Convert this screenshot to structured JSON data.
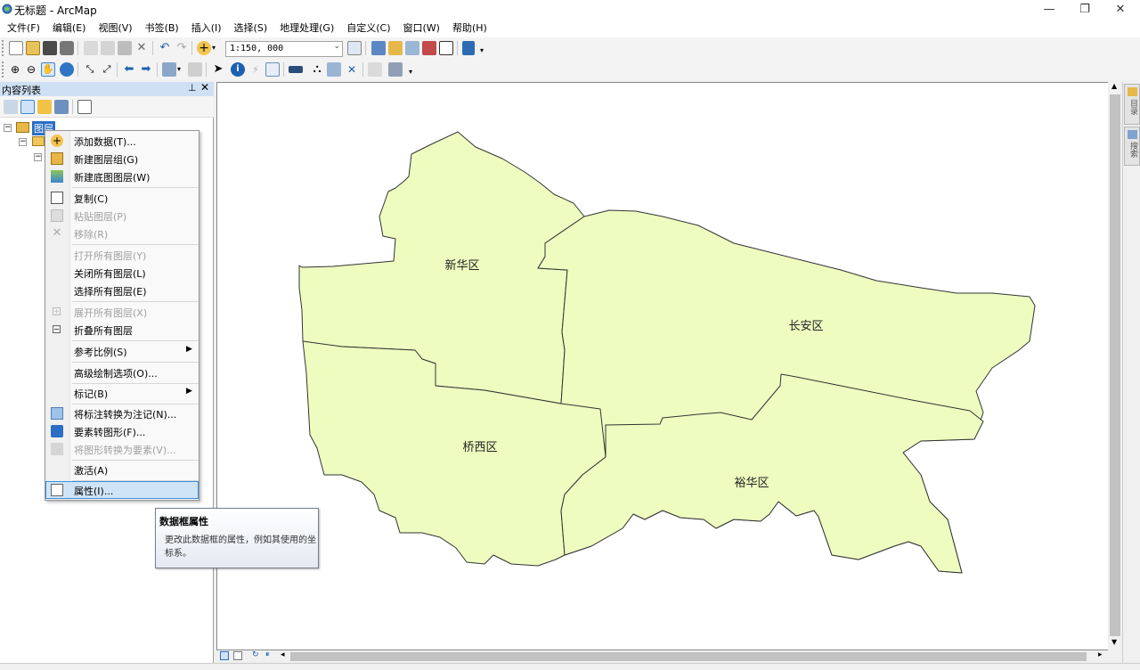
{
  "window": {
    "title": "无标题 - ArcMap",
    "minimize": "—",
    "restore": "❐",
    "close": "✕"
  },
  "menubar": [
    "文件(F)",
    "编辑(E)",
    "视图(V)",
    "书签(B)",
    "插入(I)",
    "选择(S)",
    "地理处理(G)",
    "自定义(C)",
    "窗口(W)",
    "帮助(H)"
  ],
  "toolbar": {
    "scale": "1:150, 000"
  },
  "toc": {
    "title": "内容列表",
    "pin": "ᵖ",
    "close": "✕",
    "root_layer": "图层"
  },
  "context_menu": {
    "items": [
      {
        "label": "添加数据(T)...",
        "icon": "add-data-icon",
        "enabled": true
      },
      {
        "label": "新建图层组(G)",
        "icon": "new-group-layer-icon",
        "enabled": true
      },
      {
        "label": "新建底图图层(W)",
        "icon": "new-basemap-layer-icon",
        "enabled": true
      },
      {
        "label": "复制(C)",
        "icon": "copy-icon",
        "enabled": true
      },
      {
        "label": "粘贴图层(P)",
        "icon": "paste-icon",
        "enabled": false
      },
      {
        "label": "移除(R)",
        "icon": "remove-icon",
        "enabled": false
      },
      {
        "label": "打开所有图层(Y)",
        "icon": "",
        "enabled": false
      },
      {
        "label": "关闭所有图层(L)",
        "icon": "",
        "enabled": true
      },
      {
        "label": "选择所有图层(E)",
        "icon": "",
        "enabled": true
      },
      {
        "label": "展开所有图层(X)",
        "icon": "expand-icon",
        "enabled": false
      },
      {
        "label": "折叠所有图层",
        "icon": "collapse-icon",
        "enabled": true
      },
      {
        "label": "参考比例(S)",
        "icon": "",
        "enabled": true,
        "submenu": true
      },
      {
        "label": "高级绘制选项(O)...",
        "icon": "",
        "enabled": true
      },
      {
        "label": "标记(B)",
        "icon": "",
        "enabled": true,
        "submenu": true
      },
      {
        "label": "将标注转换为注记(N)...",
        "icon": "convert-labels-icon",
        "enabled": true
      },
      {
        "label": "要素转图形(F)...",
        "icon": "features-to-graphics-icon",
        "enabled": true
      },
      {
        "label": "将图形转换为要素(V)...",
        "icon": "graphics-to-features-icon",
        "enabled": false
      },
      {
        "label": "激活(A)",
        "icon": "",
        "enabled": true
      },
      {
        "label": "属性(I)...",
        "icon": "properties-icon",
        "enabled": true,
        "highlighted": true
      }
    ]
  },
  "tooltip": {
    "title": "数据框属性",
    "body": "更改此数据框的属性，例如其使用的坐标系。"
  },
  "map": {
    "fill_color": "#eefcc0",
    "labels": {
      "xinhua": "新华区",
      "changan": "长安区",
      "qiaoxi": "桥西区",
      "yuhua": "裕华区"
    }
  },
  "right_dock": {
    "catalog": "目录",
    "search": "搜索"
  }
}
